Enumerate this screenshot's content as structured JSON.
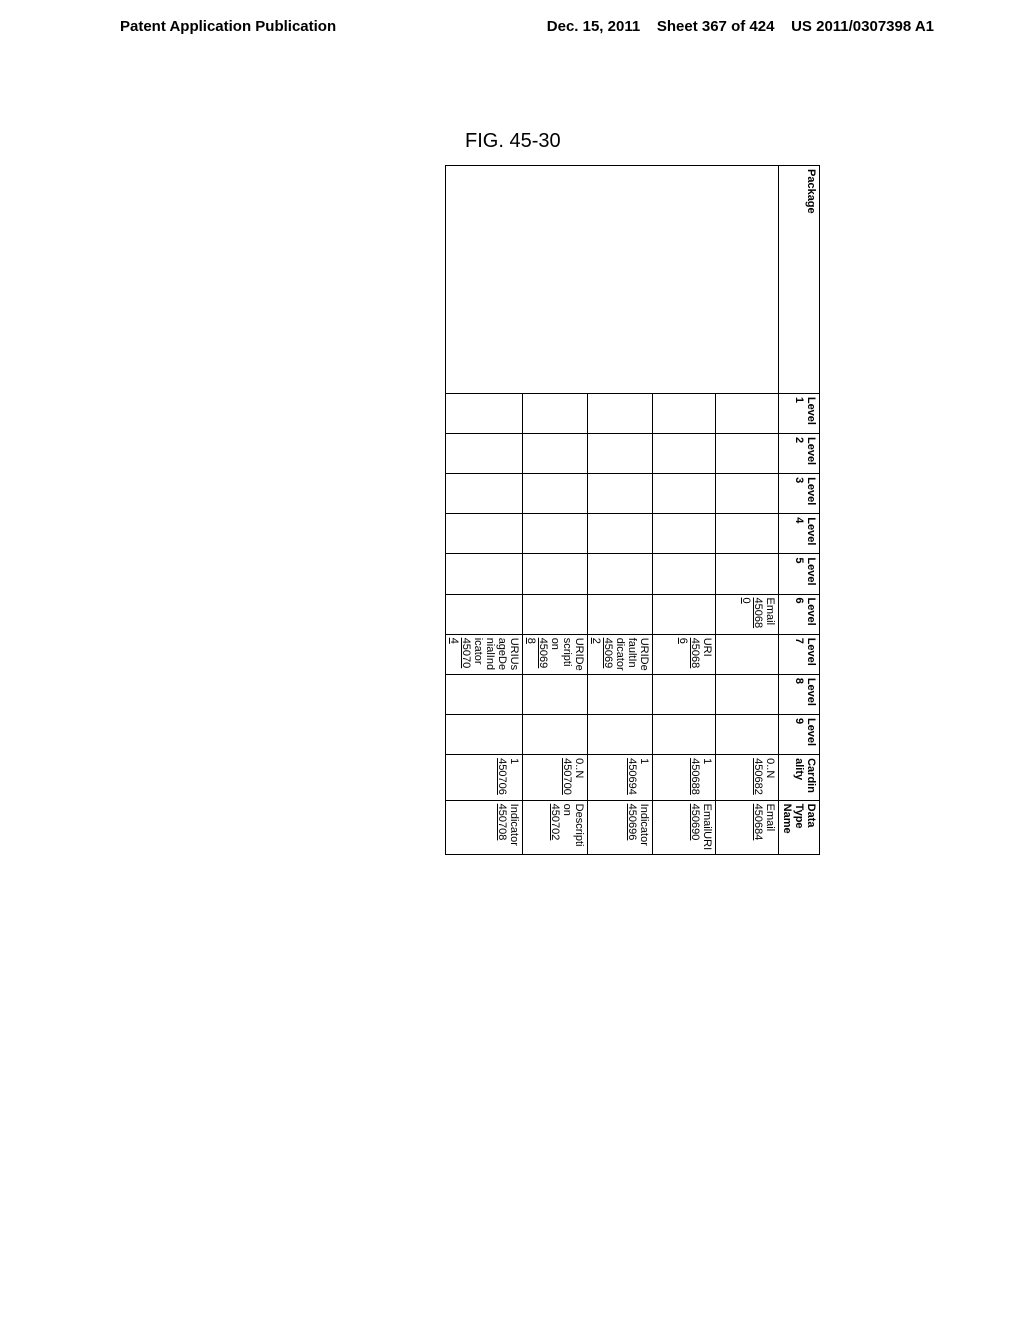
{
  "header": {
    "left": "Patent Application Publication",
    "date": "Dec. 15, 2011",
    "sheet": "Sheet 367 of 424",
    "pubno": "US 2011/0307398 A1"
  },
  "figure_label": "FIG. 45-30",
  "columns": {
    "package": "Package",
    "l1": "Level 1",
    "l2": "Level 2",
    "l3": "Level 3",
    "l4": "Level 4",
    "l5": "Level 5",
    "l6": "Level 6",
    "l7": "Level 7",
    "l8": "Level 8",
    "l9": "Level 9",
    "card": "Cardinality",
    "dtn": "Data Type Name"
  },
  "rows": [
    {
      "l6": "Email",
      "l6_ref": "450680",
      "card": "0..N",
      "card_ref": "450682",
      "dtn": "Email",
      "dtn_ref": "450684"
    },
    {
      "l7": "URI",
      "l7_ref": "450686",
      "card": "1",
      "card_ref": "450688",
      "dtn": "EmailURI",
      "dtn_ref": "450690"
    },
    {
      "l7": "URIDefaultIndicator",
      "l7_ref": "450692",
      "card": "1",
      "card_ref": "450694",
      "dtn": "Indicator",
      "dtn_ref": "450696"
    },
    {
      "l7": "URIDescription",
      "l7_ref": "450698",
      "card": "0..N",
      "card_ref": "450700",
      "dtn": "Description",
      "dtn_ref": "450702"
    },
    {
      "l7": "URIUsageDenialIndicator",
      "l7_ref": "450704",
      "card": "1",
      "card_ref": "450706",
      "dtn": "Indicator",
      "dtn_ref": "450708"
    }
  ]
}
